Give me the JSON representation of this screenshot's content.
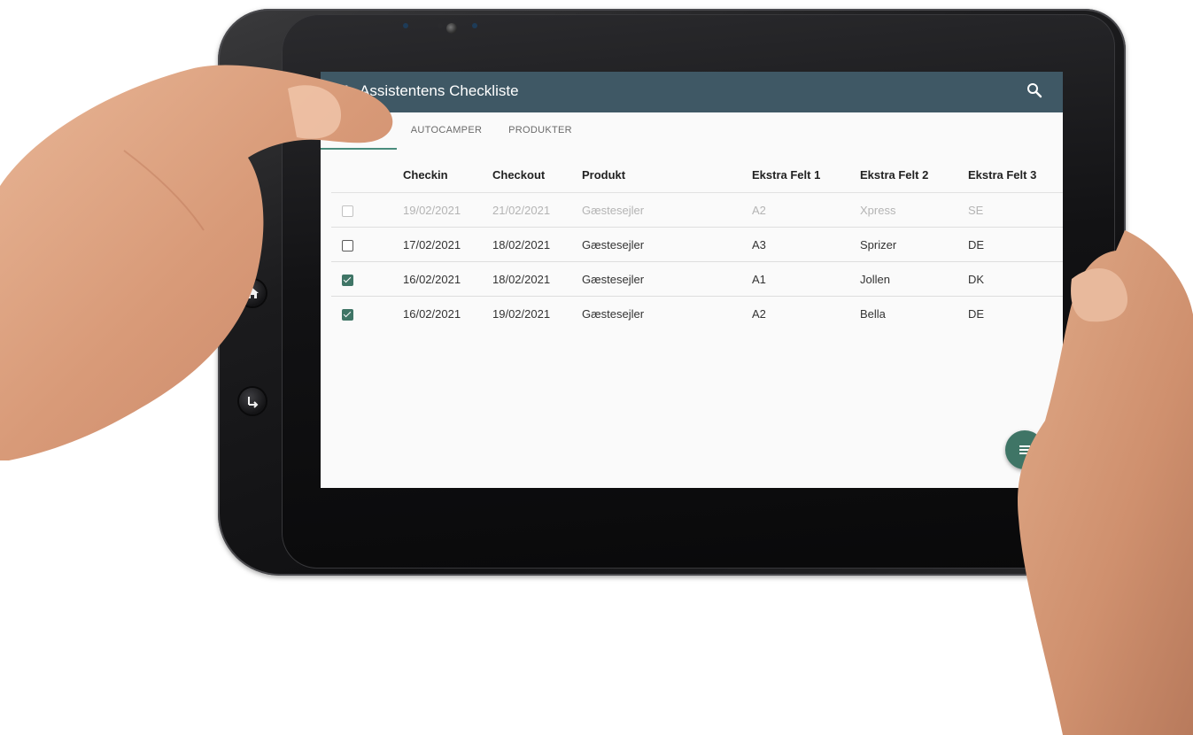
{
  "app": {
    "title": "Assistentens Checkliste",
    "menu_icon": "menu-icon",
    "search_icon": "search-icon",
    "accent_color": "#3f5865",
    "secondary_color": "#3f7566"
  },
  "tabs": [
    {
      "label": "",
      "active": true
    },
    {
      "label": "AUTOCAMPER",
      "active": false
    },
    {
      "label": "PRODUKTER",
      "active": false
    }
  ],
  "table": {
    "columns": [
      "",
      "Checkin",
      "Checkout",
      "Produkt",
      "Ekstra Felt 1",
      "Ekstra Felt 2",
      "Ekstra Felt 3"
    ],
    "rows": [
      {
        "checked": false,
        "disabled": true,
        "checkin": "19/02/2021",
        "checkout": "21/02/2021",
        "produkt": "Gæstesejler",
        "felt1": "A2",
        "felt2": "Xpress",
        "felt3": "SE"
      },
      {
        "checked": false,
        "disabled": false,
        "checkin": "17/02/2021",
        "checkout": "18/02/2021",
        "produkt": "Gæstesejler",
        "felt1": "A3",
        "felt2": "Sprizer",
        "felt3": "DE"
      },
      {
        "checked": true,
        "disabled": false,
        "checkin": "16/02/2021",
        "checkout": "18/02/2021",
        "produkt": "Gæstesejler",
        "felt1": "A1",
        "felt2": "Jollen",
        "felt3": "DK"
      },
      {
        "checked": true,
        "disabled": false,
        "checkin": "16/02/2021",
        "checkout": "19/02/2021",
        "produkt": "Gæstesejler",
        "felt1": "A2",
        "felt2": "Bella",
        "felt3": "DE"
      }
    ]
  },
  "fab": {
    "icon": "list-icon"
  },
  "device": {
    "home_icon": "home-icon",
    "back_icon": "back-icon"
  }
}
